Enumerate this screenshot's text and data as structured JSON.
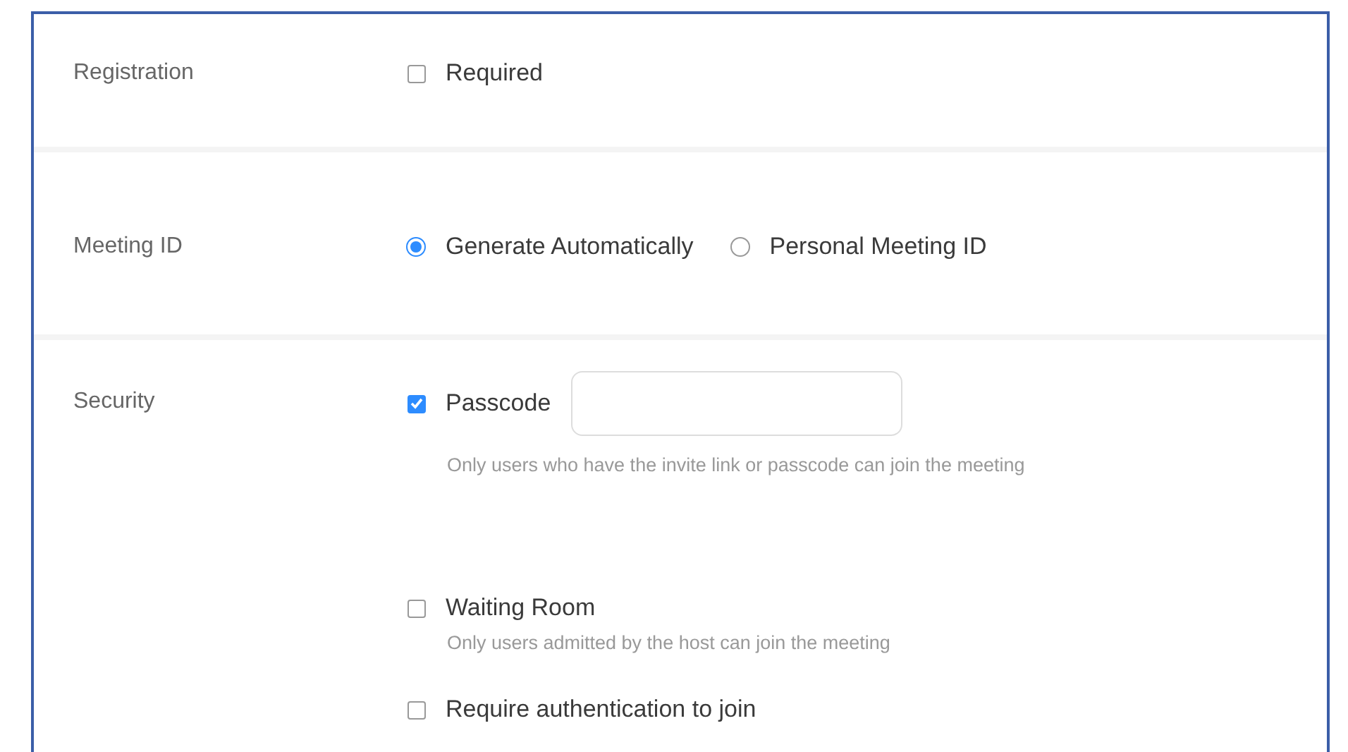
{
  "sections": [
    {
      "label": "Registration",
      "options": [
        {
          "kind": "checkbox",
          "label": "Required",
          "checked": false
        }
      ]
    },
    {
      "label": "Meeting ID",
      "options": [
        {
          "kind": "radio",
          "label": "Generate Automatically",
          "selected": true
        },
        {
          "kind": "radio",
          "label": "Personal Meeting ID",
          "selected": false
        }
      ]
    },
    {
      "label": "Security",
      "options": [
        {
          "kind": "checkbox-field",
          "label": "Passcode",
          "checked": true,
          "hint": "Only users who have the invite link or passcode can join the meeting"
        },
        {
          "kind": "checkbox",
          "label": "Waiting Room",
          "checked": false,
          "hint": "Only users admitted by the host can join the meeting"
        },
        {
          "kind": "checkbox",
          "label": "Require authentication to join",
          "checked": false
        }
      ]
    }
  ]
}
